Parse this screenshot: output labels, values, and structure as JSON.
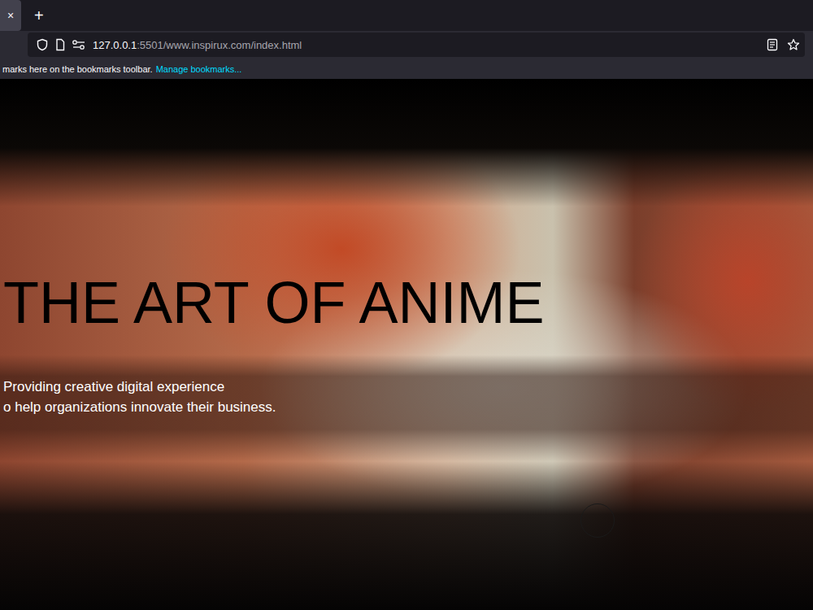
{
  "browser": {
    "tab_close": "×",
    "new_tab": "+",
    "url_host": "127.0.0.1",
    "url_path": ":5501/www.inspirux.com/index.html"
  },
  "bookmarks_bar": {
    "text": "marks here on the bookmarks toolbar.",
    "link": "Manage bookmarks..."
  },
  "page": {
    "title": "THE ART OF ANIME",
    "subtitle_lines": [
      "Providing creative digital experience",
      "o help organizations innovate their business."
    ]
  }
}
